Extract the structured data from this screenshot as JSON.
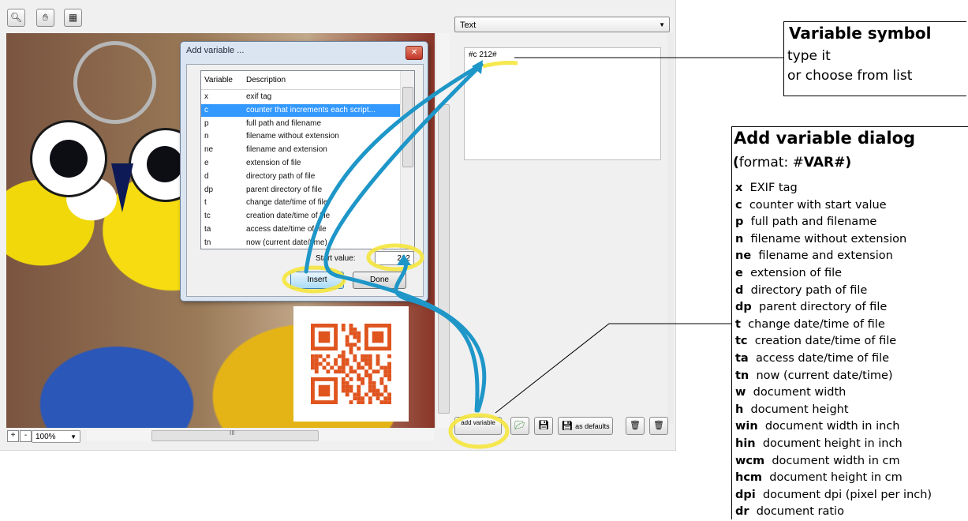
{
  "toolbar": {
    "zoom_in_icon": "zoom-in-icon",
    "pan_icon": "hand-icon",
    "qr_icon": "qr-icon"
  },
  "bottom_bar": {
    "plus": "+",
    "minus": "-",
    "zoom_level": "100%",
    "hscroll_grip": "III"
  },
  "right_panel": {
    "type_select": "Text",
    "text_value": "#c 212#",
    "add_variable_label": "add variable",
    "as_defaults_label": "as defaults"
  },
  "dialog": {
    "title": "Add variable ...",
    "columns": [
      "Variable",
      "Description"
    ],
    "rows": [
      {
        "var": "x",
        "desc": "exif tag"
      },
      {
        "var": "c",
        "desc": "counter that increments each script..."
      },
      {
        "var": "p",
        "desc": "full path and filename"
      },
      {
        "var": "n",
        "desc": "filename without extension"
      },
      {
        "var": "ne",
        "desc": "filename and extension"
      },
      {
        "var": "e",
        "desc": "extension of file"
      },
      {
        "var": "d",
        "desc": "directory path of file"
      },
      {
        "var": "dp",
        "desc": "parent directory of file"
      },
      {
        "var": "t",
        "desc": "change date/time of file"
      },
      {
        "var": "tc",
        "desc": "creation date/time of file"
      },
      {
        "var": "ta",
        "desc": "access date/time of file"
      },
      {
        "var": "tn",
        "desc": "now (current date/time)"
      }
    ],
    "selected_index": 1,
    "start_label": "Start value:",
    "start_value": "212",
    "insert_label": "Insert",
    "done_label": "Done"
  },
  "annotation_symbol": {
    "title": "Variable symbol",
    "line1": "type it",
    "line2": "or choose from list"
  },
  "annotation_dialog": {
    "title": "Add variable dialog",
    "format_open": "(",
    "format_text": "format: #",
    "format_var": "VAR#",
    "format_close": ")",
    "items": [
      {
        "code": "x",
        "desc": "EXIF tag"
      },
      {
        "code": "c",
        "desc": "counter with start value"
      },
      {
        "code": "p",
        "desc": "full path and filename"
      },
      {
        "code": "n",
        "desc": "filename without extension"
      },
      {
        "code": "ne",
        "desc": "filename and extension"
      },
      {
        "code": "e",
        "desc": "extension of file"
      },
      {
        "code": "d",
        "desc": "directory path of file"
      },
      {
        "code": "dp",
        "desc": "parent directory of file"
      },
      {
        "code": "t",
        "desc": "change date/time of file"
      },
      {
        "code": "tc",
        "desc": "creation date/time of file"
      },
      {
        "code": "ta",
        "desc": "access date/time of file"
      },
      {
        "code": "tn",
        "desc": "now (current date/time)"
      },
      {
        "code": "w",
        "desc": "document width"
      },
      {
        "code": "h",
        "desc": "document height"
      },
      {
        "code": "win",
        "desc": "document width in inch"
      },
      {
        "code": "hin",
        "desc": "document height in inch"
      },
      {
        "code": "wcm",
        "desc": "document width in cm"
      },
      {
        "code": "hcm",
        "desc": "document height in cm"
      },
      {
        "code": "dpi",
        "desc": "document dpi (pixel per inch)"
      },
      {
        "code": "dr",
        "desc": "document ratio"
      }
    ]
  },
  "colors": {
    "highlight": "#f5e63c",
    "arrow": "#1e96c8",
    "qr": "#e0541e",
    "selection": "#3399ff"
  }
}
